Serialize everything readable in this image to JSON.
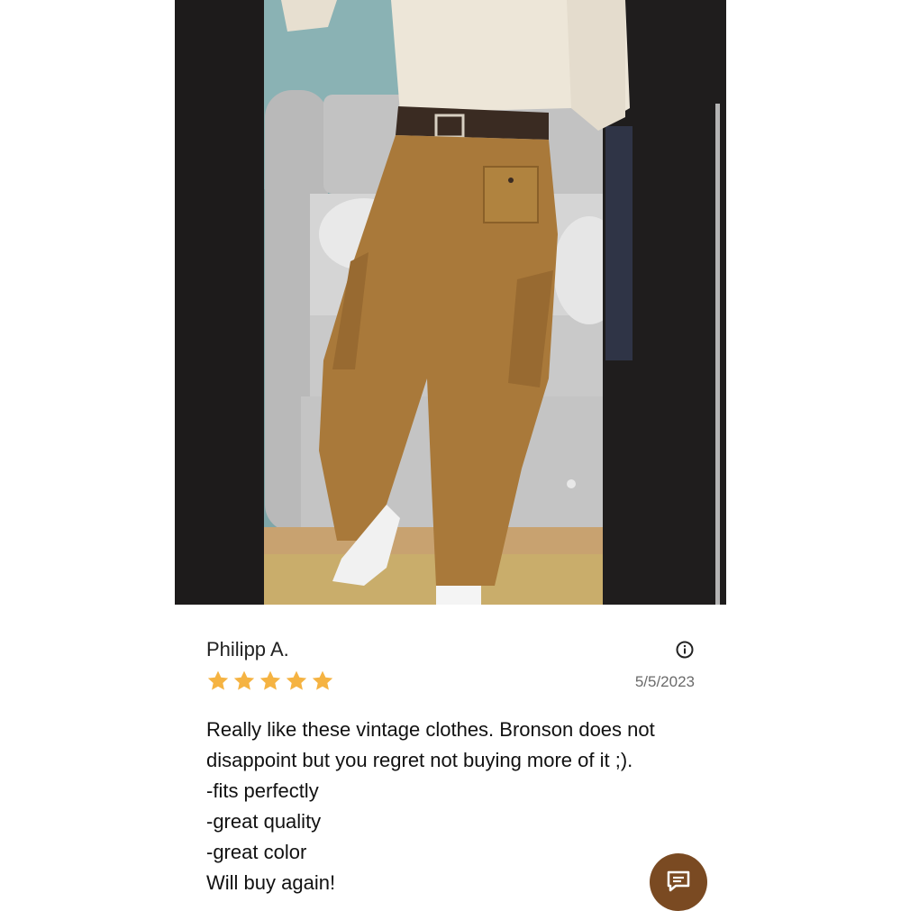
{
  "review": {
    "reviewer": "Philipp A.",
    "date": "5/5/2023",
    "rating": 5,
    "rating_max": 5,
    "text_lines": [
      "Really like these vintage clothes. Bronson does not",
      "disappoint but you regret not buying more of it ;).",
      "-fits perfectly",
      "-great quality",
      "-great color",
      "Will buy again!"
    ]
  },
  "icons": {
    "info": "info-icon",
    "star": "star-icon",
    "chat": "chat-icon"
  },
  "colors": {
    "star": "#f5b342",
    "chat_button": "#7a4a22",
    "photo_frame": "#1d1b1b",
    "pants": "#a9793a"
  }
}
